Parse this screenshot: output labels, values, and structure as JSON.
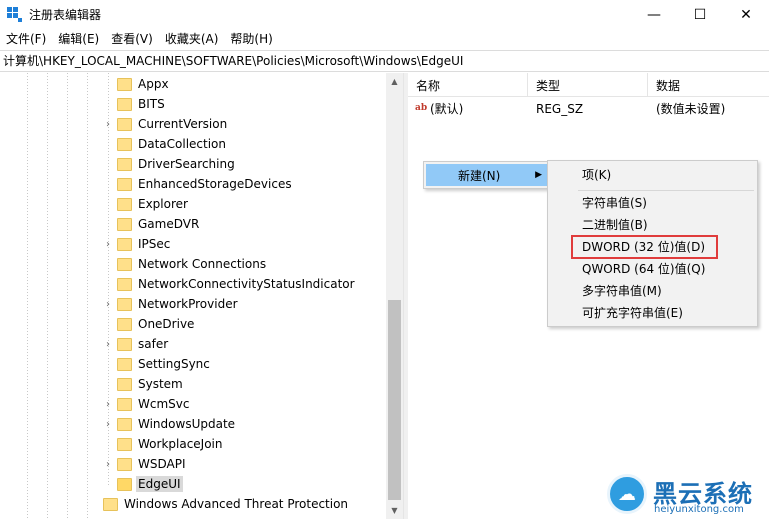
{
  "window": {
    "title": "注册表编辑器",
    "minimize": "—",
    "maximize": "☐",
    "close": "✕"
  },
  "menu": [
    "文件(F)",
    "编辑(E)",
    "查看(V)",
    "收藏夹(A)",
    "帮助(H)"
  ],
  "address": "计算机\\HKEY_LOCAL_MACHINE\\SOFTWARE\\Policies\\Microsoft\\Windows\\EdgeUI",
  "tree": {
    "items": [
      {
        "label": "Appx",
        "expandable": false
      },
      {
        "label": "BITS",
        "expandable": false
      },
      {
        "label": "CurrentVersion",
        "expandable": true
      },
      {
        "label": "DataCollection",
        "expandable": false
      },
      {
        "label": "DriverSearching",
        "expandable": false
      },
      {
        "label": "EnhancedStorageDevices",
        "expandable": false
      },
      {
        "label": "Explorer",
        "expandable": false
      },
      {
        "label": "GameDVR",
        "expandable": false
      },
      {
        "label": "IPSec",
        "expandable": true
      },
      {
        "label": "Network Connections",
        "expandable": false
      },
      {
        "label": "NetworkConnectivityStatusIndicator",
        "expandable": false
      },
      {
        "label": "NetworkProvider",
        "expandable": true
      },
      {
        "label": "OneDrive",
        "expandable": false
      },
      {
        "label": "safer",
        "expandable": true
      },
      {
        "label": "SettingSync",
        "expandable": false
      },
      {
        "label": "System",
        "expandable": false
      },
      {
        "label": "WcmSvc",
        "expandable": true
      },
      {
        "label": "WindowsUpdate",
        "expandable": true
      },
      {
        "label": "WorkplaceJoin",
        "expandable": false
      },
      {
        "label": "WSDAPI",
        "expandable": true
      },
      {
        "label": "EdgeUI",
        "expandable": false,
        "selected": true
      }
    ],
    "parent_item": "Windows Advanced Threat Protection"
  },
  "list": {
    "columns": [
      "名称",
      "类型",
      "数据"
    ],
    "rows": [
      {
        "name": "(默认)",
        "type": "REG_SZ",
        "data": "(数值未设置)"
      }
    ]
  },
  "context_menu": {
    "new_label": "新建(N)",
    "submenu": [
      "项(K)",
      "字符串值(S)",
      "二进制值(B)",
      "DWORD (32 位)值(D)",
      "QWORD (64 位)值(Q)",
      "多字符串值(M)",
      "可扩充字符串值(E)"
    ],
    "highlighted": "DWORD (32 位)值(D)",
    "highlight_color": "#e03c3c"
  },
  "watermark": {
    "name": "黑云系统",
    "url": "heiyunxitong.com"
  },
  "colors": {
    "accent": "#1e7fd8",
    "menu_hover": "#91c9f7",
    "folder": "#ffe08a"
  }
}
